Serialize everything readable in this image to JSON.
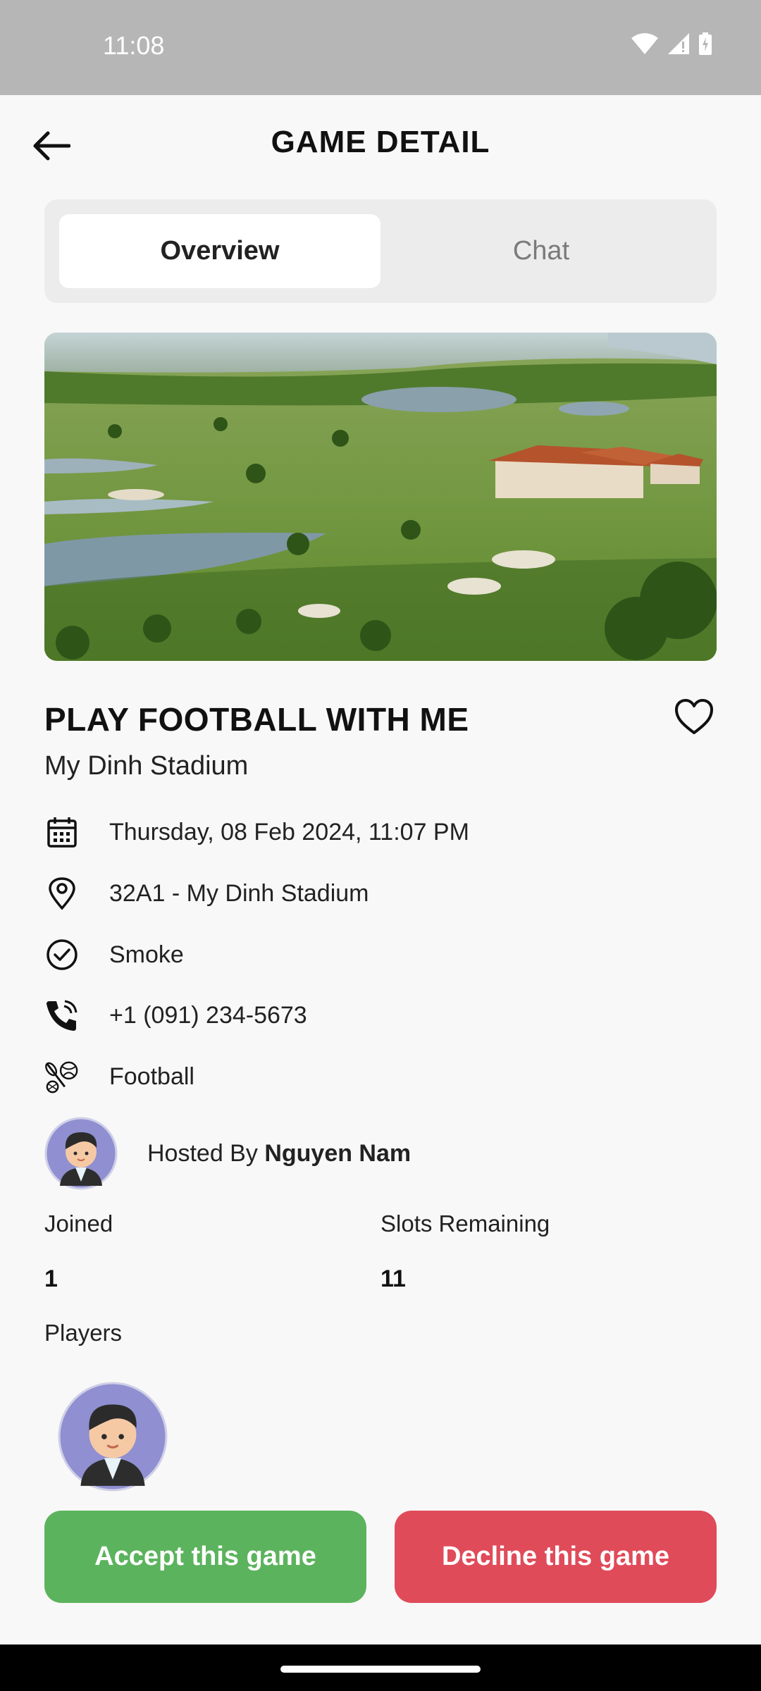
{
  "status_bar": {
    "time": "11:08"
  },
  "header": {
    "title": "GAME DETAIL",
    "back_icon": "arrow-left-icon"
  },
  "tabs": [
    {
      "label": "Overview",
      "active": true
    },
    {
      "label": "Chat",
      "active": false
    }
  ],
  "hero_image": {
    "icon": "golf-resort-aerial-photo"
  },
  "game": {
    "title": "PLAY FOOTBALL WITH ME",
    "venue": "My Dinh Stadium",
    "favorite_icon": "heart-outline-icon"
  },
  "details": {
    "datetime": "Thursday, 08 Feb 2024, 11:07 PM",
    "address": "32A1 - My Dinh Stadium",
    "status": "Smoke",
    "phone": "+1 (091) 234-5673",
    "sport": "Football"
  },
  "host": {
    "prefix": "Hosted By",
    "name": "Nguyen Nam"
  },
  "stats": {
    "joined_label": "Joined",
    "joined_value": "1",
    "slots_label": "Slots Remaining",
    "slots_value": "11"
  },
  "players": {
    "label": "Players"
  },
  "actions": {
    "accept_label": "Accept this game",
    "decline_label": "Decline this game"
  },
  "colors": {
    "accept": "#5cb35d",
    "decline": "#e04b5a",
    "status_bar": "#b6b6b6",
    "avatar_bg": "#8f8fd1"
  }
}
